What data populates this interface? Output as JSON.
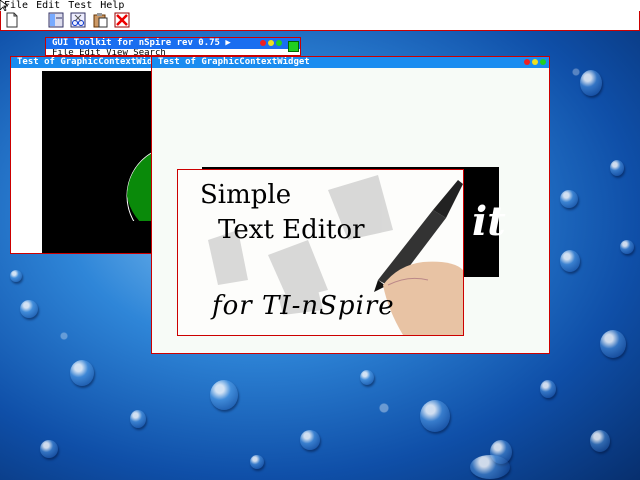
{
  "menubar": {
    "items": [
      "File",
      "Edit",
      "Test",
      "Help"
    ]
  },
  "toolbar": {
    "buttons": [
      "new-icon",
      "layout-icon",
      "scissors-icon",
      "paste-icon",
      "close-icon"
    ]
  },
  "windows": {
    "toolkit": {
      "title": "GUI Toolkit for nSpire rev 0.75 ▶",
      "submenu": "File  Edit  View  Search"
    },
    "gc1": {
      "title": "Test of GraphicContextWidget"
    },
    "gc2": {
      "title": "Test of GraphicContextWidget"
    }
  },
  "editor_image": {
    "line1": "Simple",
    "line2": "Text Editor",
    "line3": "for TI-nSpire",
    "background_text": "it"
  },
  "colors": {
    "titlebar": "#1a8cf0",
    "border": "#cc0000",
    "desktop": "#2f86d8"
  }
}
